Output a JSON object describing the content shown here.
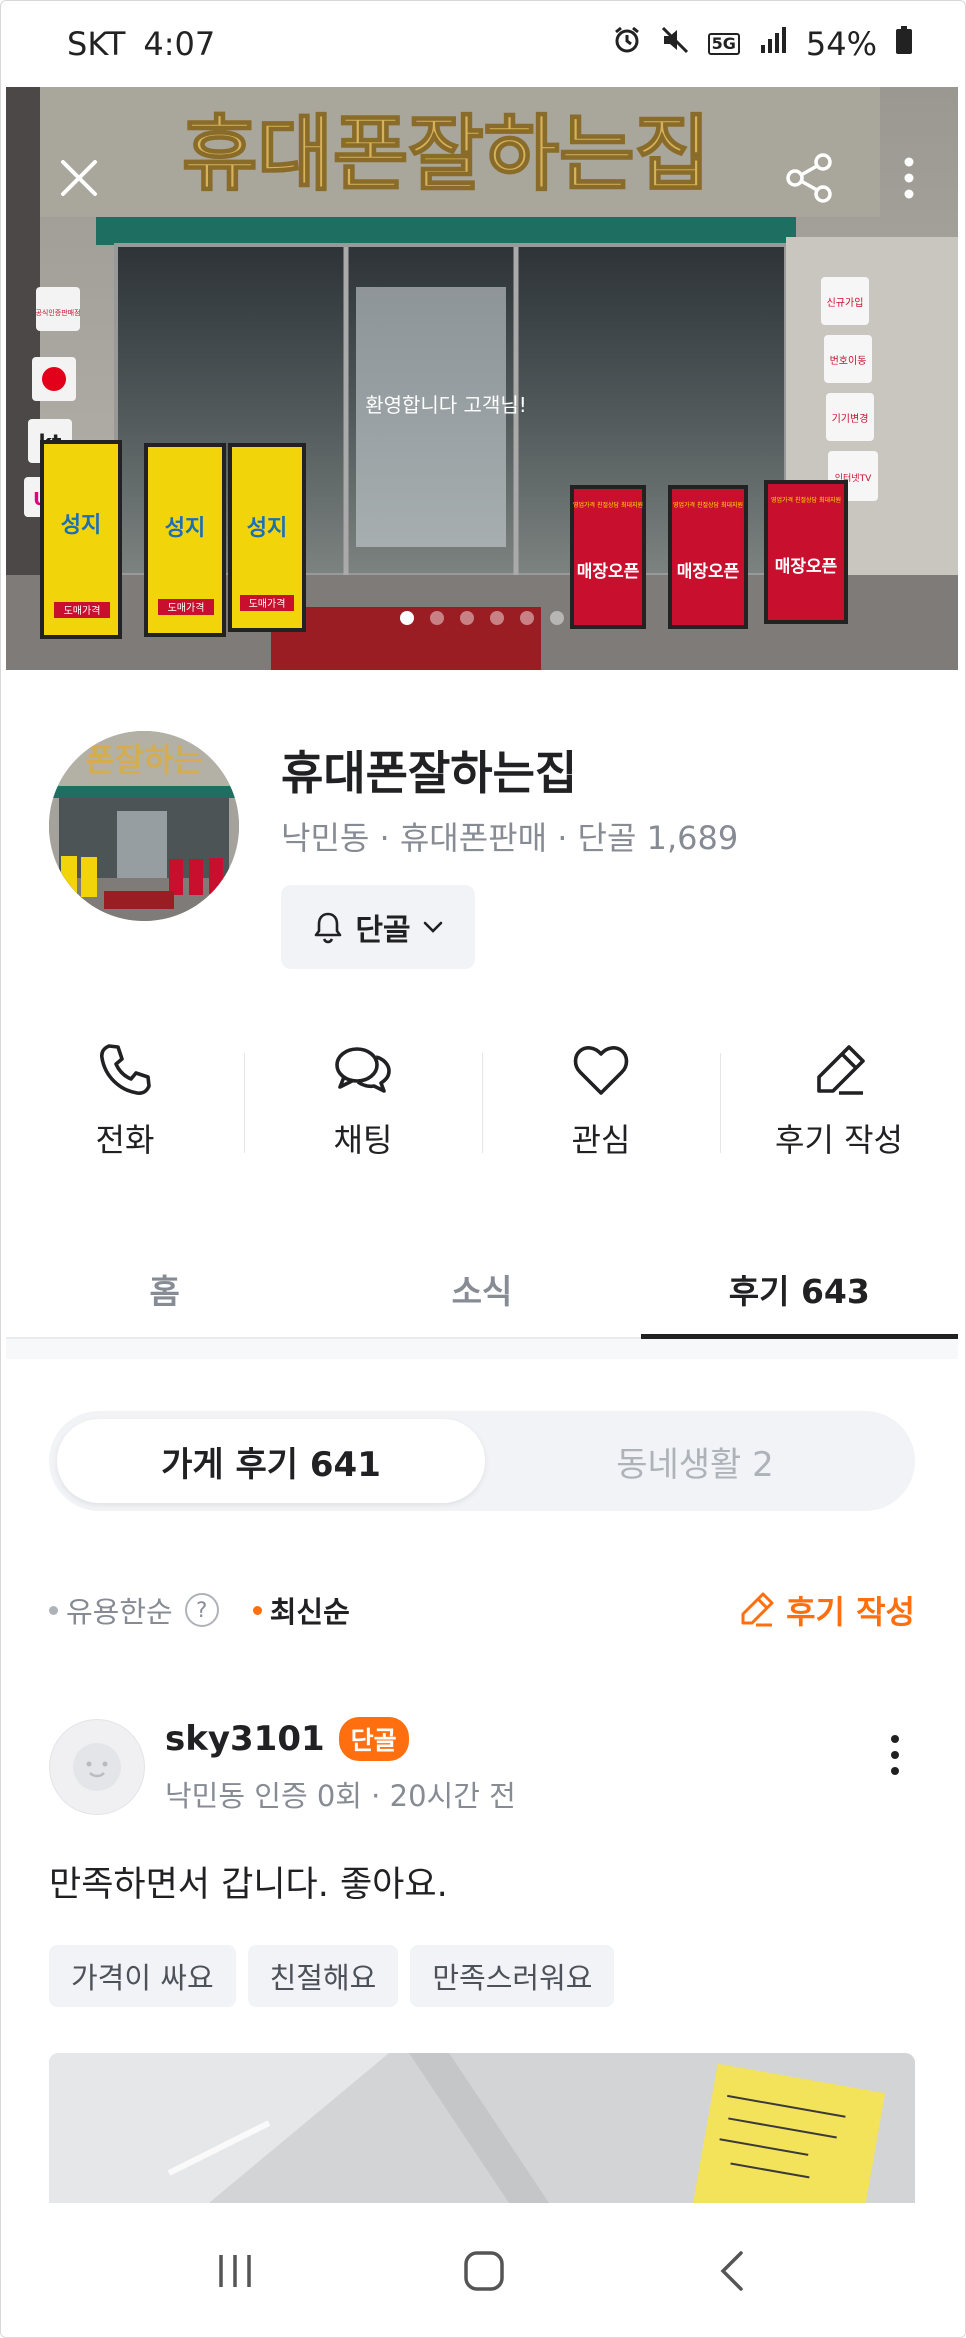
{
  "status_bar": {
    "carrier": "SKT",
    "time": "4:07",
    "network": "5G",
    "battery": "54%"
  },
  "hero": {
    "sign_text": "휴대폰잘하는집",
    "welcome_text": "환영합니다 고객님!",
    "page_dots": 6,
    "active_dot": 1,
    "side_labels": [
      "신규가입",
      "번호이동",
      "기기변경",
      "인터넷TV"
    ],
    "left_labels": [
      "공식인증판매점",
      "kt",
      "U+"
    ],
    "standee_texts": [
      "매장오픈",
      "매장오픈",
      "매장오픈"
    ],
    "standee_small": "영업가격 친절상담 최대지원",
    "yellow_board_text": "성지",
    "yellow_board_small": "도매가격"
  },
  "profile": {
    "name": "휴대폰잘하는집",
    "meta": "낙민동 · 휴대폰판매 · 단골 1,689",
    "regular_label": "단골",
    "avatar_sign": "폰잘하는"
  },
  "actions": [
    {
      "label": "전화",
      "icon": "phone-icon"
    },
    {
      "label": "채팅",
      "icon": "chat-icon"
    },
    {
      "label": "관심",
      "icon": "heart-icon"
    },
    {
      "label": "후기 작성",
      "icon": "pencil-icon"
    }
  ],
  "tabs": [
    {
      "label": "홈",
      "active": false
    },
    {
      "label": "소식",
      "active": false
    },
    {
      "label": "후기 643",
      "active": true
    }
  ],
  "review_filter": {
    "store_reviews": "가게 후기 641",
    "community_reviews": "동네생활 2"
  },
  "sort": {
    "helpful": "유용한순",
    "latest": "최신순",
    "help_symbol": "?",
    "write_review": "후기 작성"
  },
  "review": {
    "username": "sky3101",
    "badge": "단골",
    "meta": "낙민동 인증 0회 · 20시간 전",
    "text": "만족하면서 갑니다. 좋아요.",
    "chips": [
      "가격이 싸요",
      "친절해요",
      "만족스러워요"
    ]
  },
  "colors": {
    "accent": "#ff6f0f",
    "text_primary": "#212124",
    "text_secondary": "#868b94"
  }
}
